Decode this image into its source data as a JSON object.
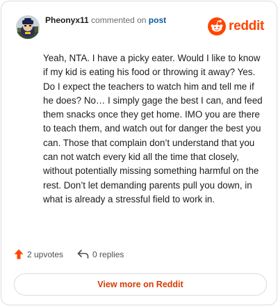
{
  "header": {
    "username": "Pheonyx11",
    "action_text": "commented on",
    "post_link": "post",
    "avatar_icon": "user-avatar-icon"
  },
  "brand": {
    "wordmark": "reddit",
    "logo_icon": "reddit-logo-icon",
    "color": "#ff4500"
  },
  "comment": {
    "text": "Yeah, NTA. I have a picky eater. Would I like to know if my kid is eating his food or throwing it away? Yes. Do I expect the teachers to watch him and tell me if he does? No… I simply gage the best I can, and feed them snacks once they get home. IMO you are there to teach them, and watch out for danger the best you can. Those that complain don’t understand that you can not watch every kid all the time that closely, without potentially missing something harmful on the rest. Don’t let demanding parents pull you down, in what is already a stressful field to work in."
  },
  "stats": {
    "upvotes": "2 upvotes",
    "replies": "0 replies",
    "upvote_icon": "upvote-arrow-icon",
    "reply_icon": "reply-arrow-icon",
    "upvote_color": "#ff4500"
  },
  "footer": {
    "view_more_label": "View more on Reddit",
    "accent": "#d93a00"
  }
}
